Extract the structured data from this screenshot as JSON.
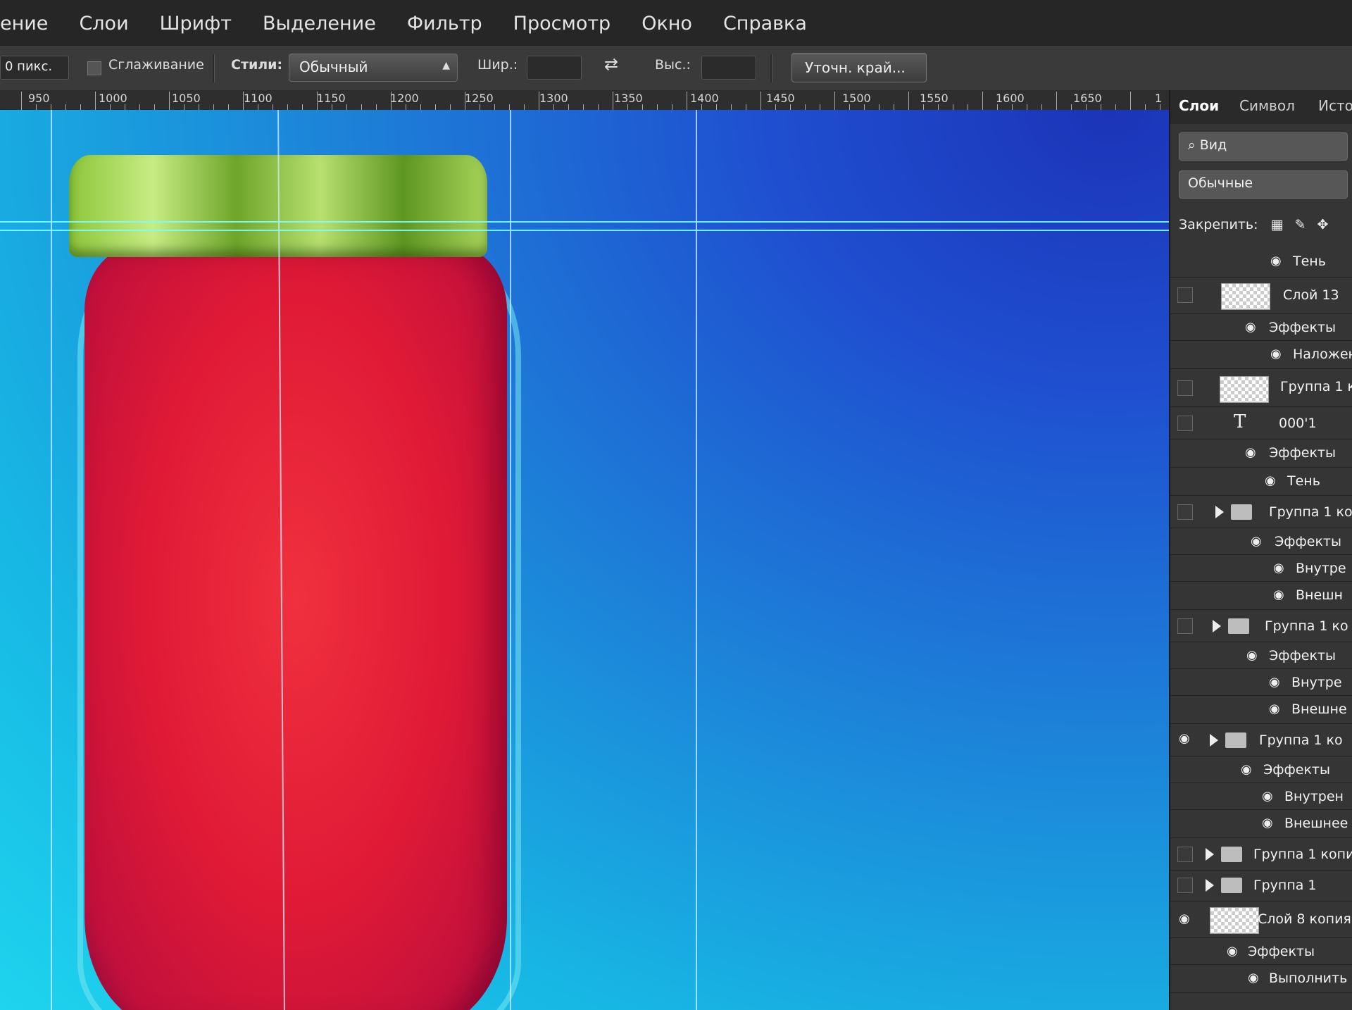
{
  "menu": [
    "ение",
    "Слои",
    "Шрифт",
    "Выделение",
    "Фильтр",
    "Просмотр",
    "Окно",
    "Справка"
  ],
  "options": {
    "feather_value": "0 пикс.",
    "antialias_label": "Сглаживание",
    "style_label": "Стили:",
    "style_value": "Обычный",
    "width_label": "Шир.:",
    "height_label": "Выс.:",
    "refine_button": "Уточн. край..."
  },
  "ruler_labels": [
    "950",
    "1000",
    "1050",
    "1100",
    "1150",
    "1200",
    "1250",
    "1300",
    "1350",
    "1400",
    "1450",
    "1500",
    "1550",
    "1600",
    "1650",
    "1"
  ],
  "panel": {
    "tabs": [
      "Слои",
      "Символ",
      "Исто"
    ],
    "filter_value": "Вид",
    "blend_value": "Обычные",
    "lock_label": "Закрепить:",
    "layers": [
      {
        "name": "Тень"
      },
      {
        "name": "Слой 13"
      },
      {
        "name": "Эффекты"
      },
      {
        "name": "Наложен"
      },
      {
        "name": "Группа 1 к"
      },
      {
        "name": "000'1"
      },
      {
        "name": "Эффекты"
      },
      {
        "name": "Тень"
      },
      {
        "name": "Группа 1 ко"
      },
      {
        "name": "Эффекты"
      },
      {
        "name": "Внутре"
      },
      {
        "name": "Внешн"
      },
      {
        "name": "Группа 1 ко"
      },
      {
        "name": "Эффекты"
      },
      {
        "name": "Внутре"
      },
      {
        "name": "Внешне"
      },
      {
        "name": "Группа 1 ко"
      },
      {
        "name": "Эффекты"
      },
      {
        "name": "Внутрен"
      },
      {
        "name": "Внешнее"
      },
      {
        "name": "Группа 1 копи"
      },
      {
        "name": "Группа 1"
      },
      {
        "name": "Слой 8 копия"
      },
      {
        "name": "Эффекты"
      },
      {
        "name": "Выполнить"
      }
    ]
  },
  "icons": {
    "eye": "eye-icon",
    "folder": "folder-icon",
    "text_layer": "T",
    "expand": "triangle-right"
  }
}
